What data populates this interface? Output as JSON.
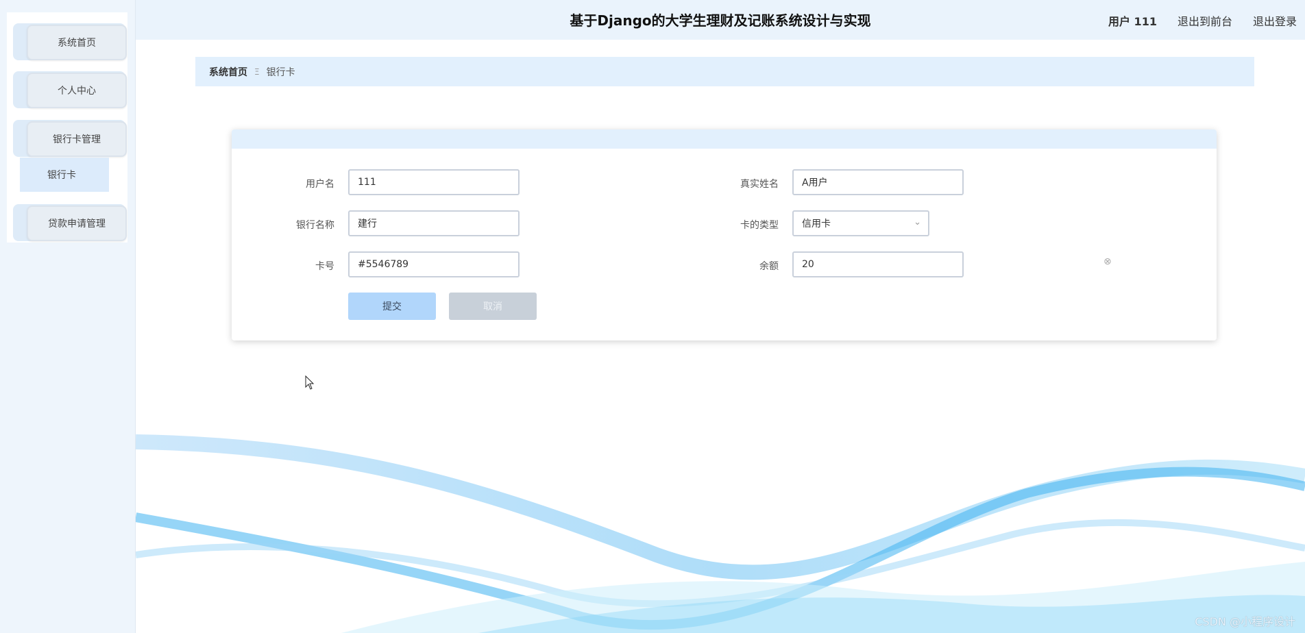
{
  "sidebar": {
    "items": [
      {
        "label": "系统首页"
      },
      {
        "label": "个人中心"
      },
      {
        "label": "银行卡管理"
      },
      {
        "label": "贷款申请管理"
      }
    ],
    "submenu": {
      "label": "银行卡"
    }
  },
  "header": {
    "title": "基于Django的大学生理财及记账系统设计与实现",
    "user": "用户 111",
    "front_link": "退出到前台",
    "logout_link": "退出登录"
  },
  "breadcrumb": {
    "home": "系统首页",
    "separator": "Ξ",
    "current": "银行卡"
  },
  "form": {
    "username": {
      "label": "用户名",
      "value": "111"
    },
    "realname": {
      "label": "真实姓名",
      "value": "A用户"
    },
    "bankname": {
      "label": "银行名称",
      "value": "建行"
    },
    "cardtype": {
      "label": "卡的类型",
      "value": "信用卡"
    },
    "cardno": {
      "label": "卡号",
      "value": "#5546789"
    },
    "balance": {
      "label": "余额",
      "value": "20"
    },
    "submit_label": "提交",
    "cancel_label": "取消"
  },
  "watermark": "CSDN @小程序设计",
  "colors": {
    "accent": "#b1d6fb",
    "header_bg": "#eaf3fc",
    "sidebar_bg": "#eef5fc"
  }
}
